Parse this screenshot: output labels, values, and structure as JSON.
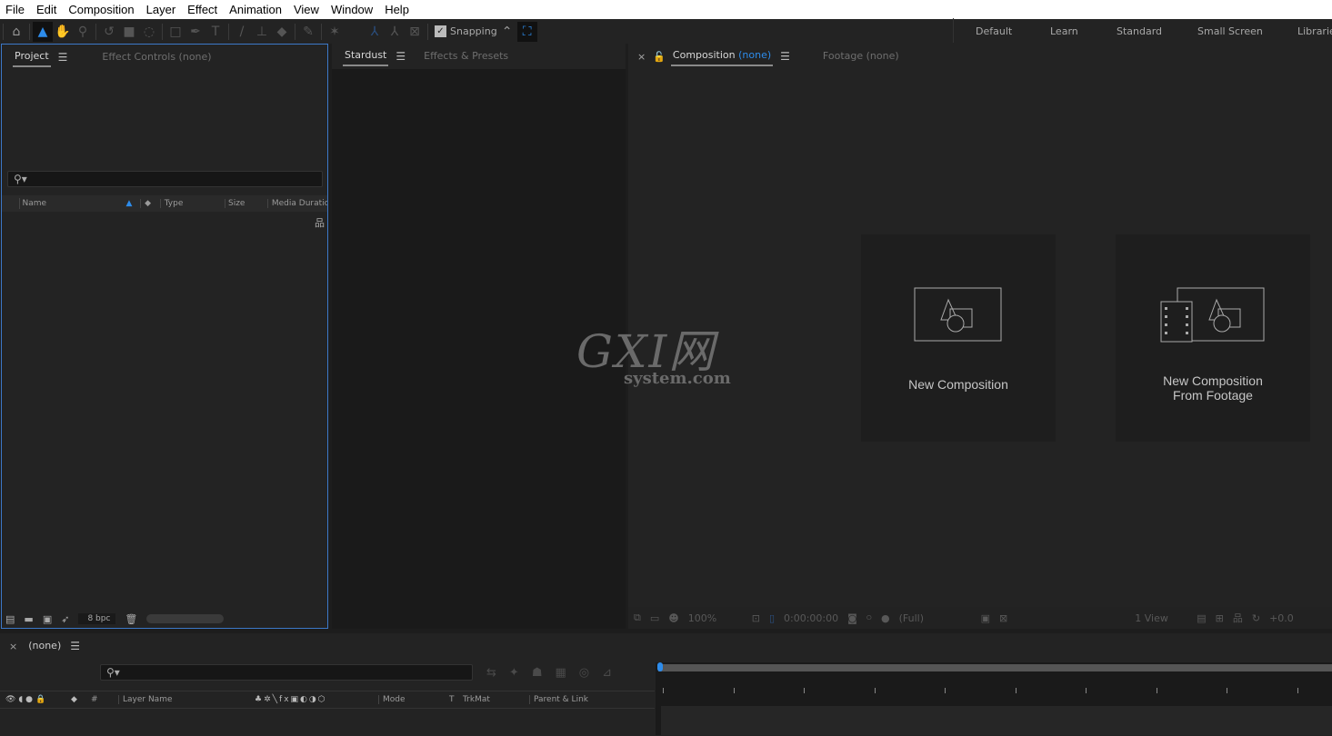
{
  "menu": [
    "File",
    "Edit",
    "Composition",
    "Layer",
    "Effect",
    "Animation",
    "View",
    "Window",
    "Help"
  ],
  "toolbar": {
    "snapping_label": "Snapping",
    "snapping_checked": true
  },
  "workspaces": [
    "Default",
    "Learn",
    "Standard",
    "Small Screen",
    "Librarie"
  ],
  "project_panel": {
    "tabs": [
      "Project",
      "Effect Controls (none)"
    ],
    "columns": [
      "Name",
      "Type",
      "Size",
      "Media Duratic"
    ],
    "bpc": "8 bpc"
  },
  "stardust_panel": {
    "tabs": [
      "Stardust",
      "Effects & Presets"
    ]
  },
  "comp_panel": {
    "tab_label": "Composition",
    "tab_sub": "(none)",
    "footage_tab": "Footage  (none)",
    "cards": [
      "New Composition",
      "New Composition",
      "From Footage"
    ],
    "footer": {
      "zoom": "100%",
      "timecode": "0:00:00:00",
      "resolution": "(Full)",
      "view": "1 View",
      "exposure": "+0.0"
    }
  },
  "timeline": {
    "tab": "(none)",
    "columns": [
      "#",
      "Layer Name",
      "Mode",
      "T",
      "TrkMat",
      "Parent & Link"
    ]
  },
  "watermark": {
    "text": "GXI网",
    "sub": "system.com"
  },
  "colors": {
    "accent": "#2d8ceb",
    "panel_focus": "#3c78c8"
  }
}
